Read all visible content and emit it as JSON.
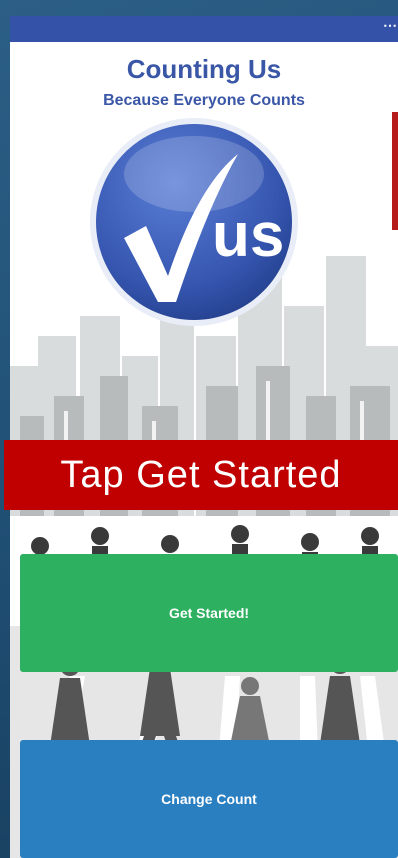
{
  "app": {
    "title": "Counting Us",
    "subtitle": "Because Everyone Counts",
    "logo_text": "us"
  },
  "overlay": {
    "instruction": "Tap Get Started"
  },
  "buttons": {
    "get_started": "Get Started!",
    "change_count": "Change Count"
  },
  "icons": {
    "menu": "menu-dots-icon",
    "logo": "checkmark-us-logo"
  },
  "colors": {
    "header_blue": "#3452a8",
    "title_blue": "#3a56a7",
    "banner_red": "#c00000",
    "start_green": "#2db05f",
    "change_blue": "#2a7fc0"
  }
}
